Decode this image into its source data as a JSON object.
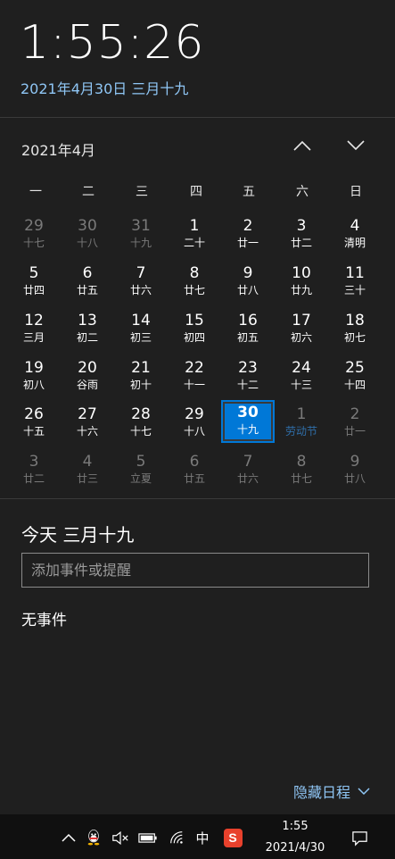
{
  "clock": {
    "time": "1:55:26",
    "full_date": "2021年4月30日 三月十九"
  },
  "calendar": {
    "month_label": "2021年4月",
    "weekdays": [
      "一",
      "二",
      "三",
      "四",
      "五",
      "六",
      "日"
    ],
    "days": [
      {
        "n": "29",
        "l": "十七",
        "state": "out"
      },
      {
        "n": "30",
        "l": "十八",
        "state": "out"
      },
      {
        "n": "31",
        "l": "十九",
        "state": "out"
      },
      {
        "n": "1",
        "l": "二十",
        "state": "in"
      },
      {
        "n": "2",
        "l": "廿一",
        "state": "in"
      },
      {
        "n": "3",
        "l": "廿二",
        "state": "in"
      },
      {
        "n": "4",
        "l": "清明",
        "state": "in"
      },
      {
        "n": "5",
        "l": "廿四",
        "state": "in"
      },
      {
        "n": "6",
        "l": "廿五",
        "state": "in"
      },
      {
        "n": "7",
        "l": "廿六",
        "state": "in"
      },
      {
        "n": "8",
        "l": "廿七",
        "state": "in"
      },
      {
        "n": "9",
        "l": "廿八",
        "state": "in"
      },
      {
        "n": "10",
        "l": "廿九",
        "state": "in"
      },
      {
        "n": "11",
        "l": "三十",
        "state": "in"
      },
      {
        "n": "12",
        "l": "三月",
        "state": "in"
      },
      {
        "n": "13",
        "l": "初二",
        "state": "in"
      },
      {
        "n": "14",
        "l": "初三",
        "state": "in"
      },
      {
        "n": "15",
        "l": "初四",
        "state": "in"
      },
      {
        "n": "16",
        "l": "初五",
        "state": "in"
      },
      {
        "n": "17",
        "l": "初六",
        "state": "in"
      },
      {
        "n": "18",
        "l": "初七",
        "state": "in"
      },
      {
        "n": "19",
        "l": "初八",
        "state": "in"
      },
      {
        "n": "20",
        "l": "谷雨",
        "state": "in"
      },
      {
        "n": "21",
        "l": "初十",
        "state": "in"
      },
      {
        "n": "22",
        "l": "十一",
        "state": "in"
      },
      {
        "n": "23",
        "l": "十二",
        "state": "in"
      },
      {
        "n": "24",
        "l": "十三",
        "state": "in"
      },
      {
        "n": "25",
        "l": "十四",
        "state": "in"
      },
      {
        "n": "26",
        "l": "十五",
        "state": "in"
      },
      {
        "n": "27",
        "l": "十六",
        "state": "in"
      },
      {
        "n": "28",
        "l": "十七",
        "state": "in"
      },
      {
        "n": "29",
        "l": "十八",
        "state": "in"
      },
      {
        "n": "30",
        "l": "十九",
        "state": "today"
      },
      {
        "n": "1",
        "l": "劳动节",
        "state": "out holiday"
      },
      {
        "n": "2",
        "l": "廿一",
        "state": "out"
      },
      {
        "n": "3",
        "l": "廿二",
        "state": "out"
      },
      {
        "n": "4",
        "l": "廿三",
        "state": "out"
      },
      {
        "n": "5",
        "l": "立夏",
        "state": "out"
      },
      {
        "n": "6",
        "l": "廿五",
        "state": "out"
      },
      {
        "n": "7",
        "l": "廿六",
        "state": "out"
      },
      {
        "n": "8",
        "l": "廿七",
        "state": "out"
      },
      {
        "n": "9",
        "l": "廿八",
        "state": "out"
      }
    ]
  },
  "agenda": {
    "title": "今天 三月十九",
    "input_placeholder": "添加事件或提醒",
    "no_events": "无事件",
    "hide_label": "隐藏日程"
  },
  "taskbar": {
    "icons": [
      "chevron-up-icon",
      "qq-icon",
      "volume-muted-icon",
      "battery-icon",
      "wifi-icon",
      "ime-icon",
      "sogou-icon",
      "notification-icon"
    ],
    "ime_label": "中",
    "sogou_label": "S",
    "time": "1:55",
    "date": "2021/4/30"
  },
  "colors": {
    "accent": "#0078d7",
    "link": "#8fc6f5",
    "background": "#1f1f1f",
    "taskbar": "#101010"
  }
}
